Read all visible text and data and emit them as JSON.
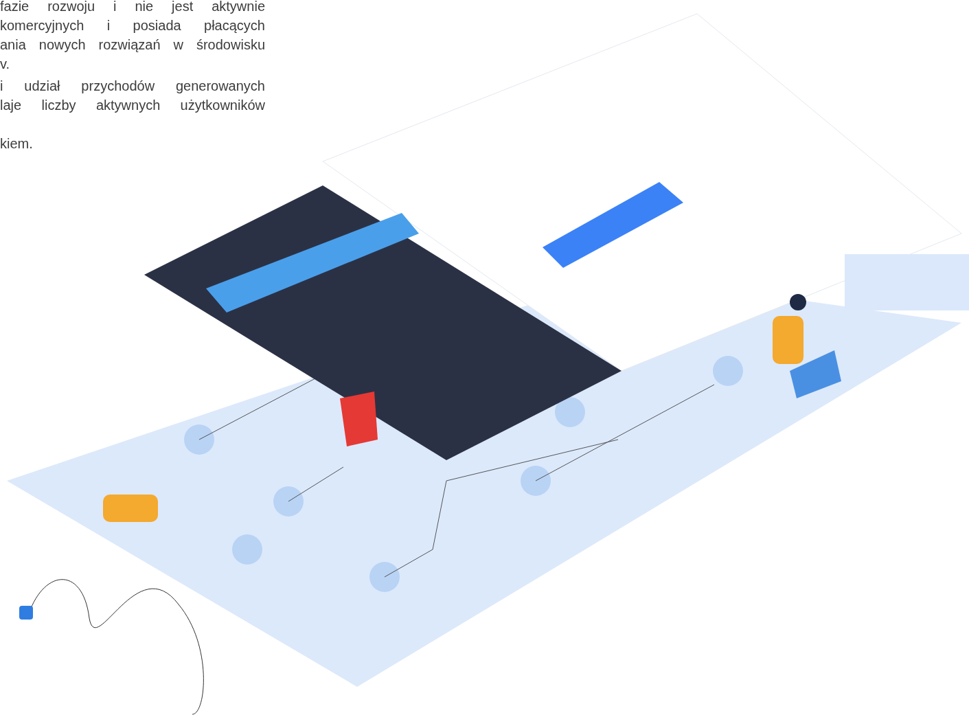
{
  "article": {
    "paragraphs": [
      {
        "lines": [
          "fazie rozwoju i nie jest aktywnie",
          "komercyjnych i posiada płacących",
          "ania nowych rozwiązań w środowisku",
          "v."
        ]
      },
      {
        "lines": [
          "i udział przychodów generowanych",
          "laje liczby aktywnych użytkowników",
          "kiem."
        ]
      }
    ]
  }
}
